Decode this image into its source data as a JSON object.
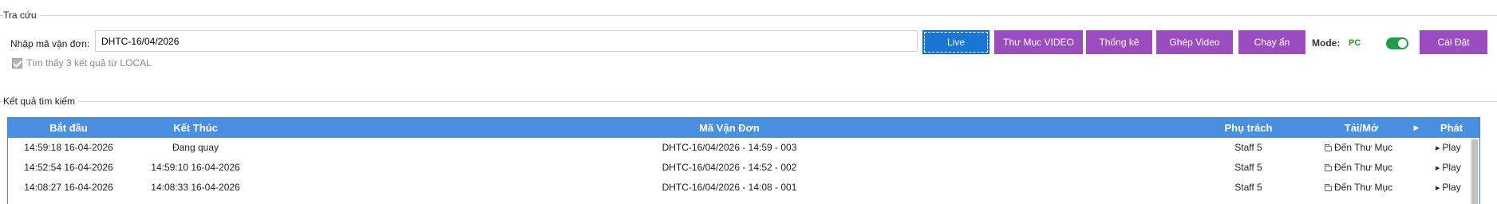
{
  "lookup": {
    "title": "Tra cứu",
    "tracking_label": "Nhập mã vận đơn:",
    "tracking_value": "DHTC-16/04/2026",
    "buttons": {
      "live": "Live",
      "video_folder": "Thư Mục VIDEO",
      "stats": "Thống kê",
      "merge_video": "Ghép Video",
      "run_hidden": "Chạy ẩn",
      "settings": "Cài Đặt"
    },
    "mode_label": "Mode:",
    "mode_value": "PC",
    "mode_toggle_on": true,
    "found_text": "Tìm thấy 3 kết quả từ LOCAL",
    "found_checked": true
  },
  "results": {
    "title": "Kết quả tìm kiếm",
    "columns": {
      "start": "Bắt đầu",
      "end": "Kết Thúc",
      "code": "Mã Vận Đơn",
      "staff": "Phụ trách",
      "download": "Tải/Mở",
      "arrow": "▶",
      "play": "Phát"
    },
    "rows": [
      {
        "start": "14:59:18 16-04-2026",
        "end": "Đang quay",
        "code": "DHTC-16/04/2026 - 14:59 - 003",
        "staff": "Staff 5",
        "download": "Đến Thư Mục",
        "play": "Play"
      },
      {
        "start": "14:52:54 16-04-2026",
        "end": "14:59:10 16-04-2026",
        "code": "DHTC-16/04/2026 - 14:52 - 002",
        "staff": "Staff 5",
        "download": "Đến Thư Mục",
        "play": "Play"
      },
      {
        "start": "14:08:27 16-04-2026",
        "end": "14:08:33 16-04-2026",
        "code": "DHTC-16/04/2026 - 14:08 - 001",
        "staff": "Staff 5",
        "download": "Đến Thư Mục",
        "play": "Play"
      }
    ]
  },
  "colors": {
    "accent_blue": "#4a8fdf",
    "live_blue": "#1976d2",
    "purple": "#9b4dc0",
    "mode_green": "#1aa31a",
    "toggle_green": "#1e9e4a"
  }
}
